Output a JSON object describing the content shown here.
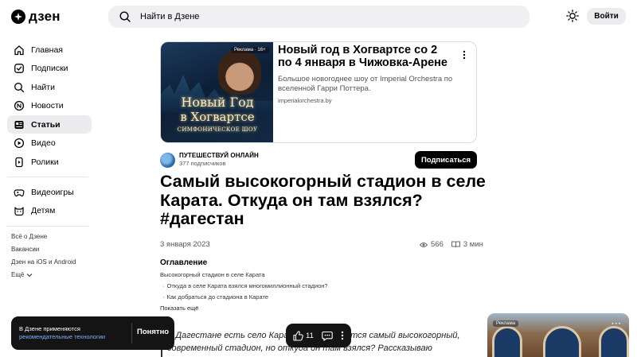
{
  "header": {
    "logo_text": "дзен",
    "search_placeholder": "Найти в Дзене",
    "login_label": "Войти"
  },
  "sidebar": {
    "items": [
      {
        "label": "Главная",
        "icon": "home-icon"
      },
      {
        "label": "Подписки",
        "icon": "subscriptions-icon"
      },
      {
        "label": "Найти",
        "icon": "search-icon"
      },
      {
        "label": "Новости",
        "icon": "news-icon"
      },
      {
        "label": "Статьи",
        "icon": "articles-icon",
        "active": true
      },
      {
        "label": "Видео",
        "icon": "video-icon"
      },
      {
        "label": "Ролики",
        "icon": "clips-icon"
      },
      {
        "label": "Видеоигры",
        "icon": "gamepad-icon"
      },
      {
        "label": "Детям",
        "icon": "kids-icon"
      }
    ],
    "links": [
      "Всё о Дзене",
      "Вакансии",
      "Дзен на iOS и Android",
      "Ещё"
    ]
  },
  "ad": {
    "badge": "Реклама · 16+",
    "image_title_line1": "Новый Год",
    "image_title_line2": "в Хогвартсе",
    "image_title_line3": "СИМФОНИЧЕСКОЕ ШОУ",
    "heading": "Новый год в Хогвартсе со 2 по 4 января в Чижовка-Арене",
    "description": "Большое новогоднее шоу от Imperial Orchestra по вселенной Гарри Поттера.",
    "url": "imperialorchestra.by"
  },
  "channel": {
    "name": "ПУТЕШЕСТВУЙ ОНЛАЙН",
    "subscribers": "377 подписчиков",
    "subscribe_label": "Подписаться"
  },
  "article": {
    "title": "Самый высокогорный стадион в селе Карата. Откуда он там взялся? #дагестан",
    "date": "3 января 2023",
    "views": "566",
    "read_time": "3 мин",
    "toc_heading": "Оглавление",
    "toc": [
      "Высокогорный стадион в селе Карата",
      "Откуда в селе Карата взялся многомиллионный стадион?",
      "Как добраться до стадиона в Карате"
    ],
    "toc_more": "Показать ещё",
    "body_line1": "В Дагестане есть село Карата, где находится самый высокогорный,",
    "body_line2": "современный стадион, но откуда он там взялся? Рассказываю"
  },
  "cookie": {
    "line1": "В Дзене применяются",
    "link": "рекомендательные технологии",
    "ok_label": "Понятно"
  },
  "action_bar": {
    "likes": "11"
  },
  "right_ad": {
    "badge": "Реклама"
  }
}
